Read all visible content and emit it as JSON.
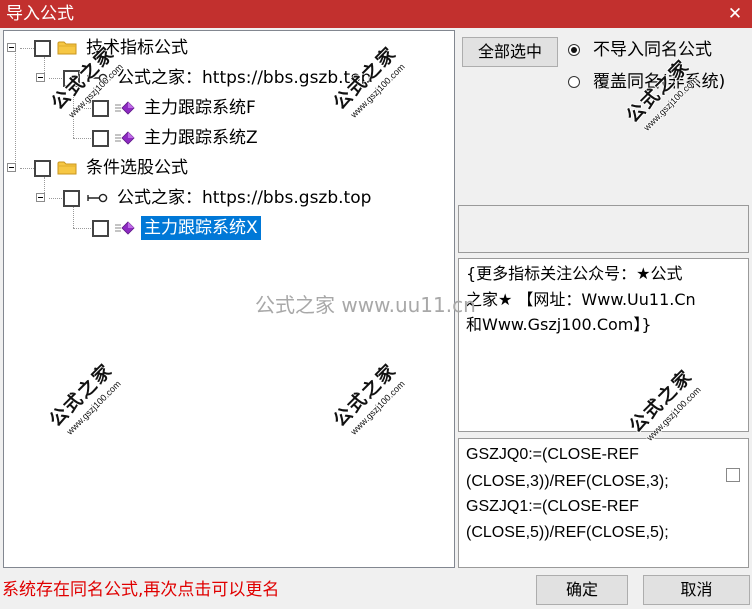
{
  "window": {
    "title": "导入公式",
    "close_icon": "close-icon",
    "close_glyph": "✕"
  },
  "tree": {
    "rows": [
      {
        "label": "技术指标公式",
        "icon": "folder-icon",
        "checked": false,
        "expanded": true
      },
      {
        "label": "公式之家：https://bbs.gszb.top",
        "icon": "key-icon",
        "checked": false,
        "expanded": true
      },
      {
        "label": "主力跟踪系统F",
        "icon": "formula-icon",
        "checked": false
      },
      {
        "label": "主力跟踪系统Z",
        "icon": "formula-icon",
        "checked": false
      },
      {
        "label": "条件选股公式",
        "icon": "folder-icon",
        "checked": false,
        "expanded": true
      },
      {
        "label": "公式之家：https://bbs.gszb.top",
        "icon": "key-icon",
        "checked": false,
        "expanded": true
      },
      {
        "label": "主力跟踪系统X",
        "icon": "formula-icon",
        "checked": false,
        "selected": true
      }
    ]
  },
  "options": {
    "select_all_label": "全部选中",
    "radios": [
      {
        "label": "不导入同名公式",
        "checked": true
      },
      {
        "label": "覆盖同名(非系统)",
        "checked": false
      }
    ]
  },
  "description": {
    "lines": [
      "{更多指标关注公众号：★公式",
      "之家★ 【网址：Www.Uu11.Cn",
      "和Www.Gszj100.Com】}"
    ]
  },
  "code": {
    "lines": [
      "GSZJQ0:=(CLOSE-REF",
      "(CLOSE,3))/REF(CLOSE,3);",
      "GSZJQ1:=(CLOSE-REF",
      "(CLOSE,5))/REF(CLOSE,5);"
    ],
    "checkbox_checked": false
  },
  "status_message": "系统存在同名公式,再次点击可以更名",
  "footer": {
    "ok_label": "确定",
    "cancel_label": "取消"
  },
  "watermarks": {
    "stamp_text": "公式之家",
    "stamp_url": "www.gszj100.com",
    "overlay_text": "公式之家 www.uu11.cn"
  },
  "colors": {
    "title_bar": "#c2302e",
    "selection": "#0078d7",
    "status_text": "#e00000"
  }
}
